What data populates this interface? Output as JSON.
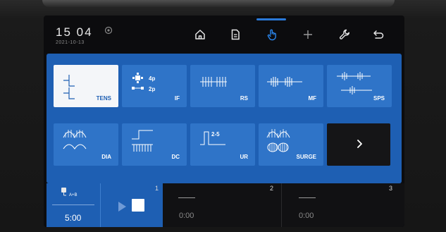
{
  "header": {
    "time": "15 04",
    "date": "2021-10-13"
  },
  "nav": [
    {
      "name": "home-icon",
      "selected": false
    },
    {
      "name": "document-icon",
      "selected": false
    },
    {
      "name": "hand-touch-icon",
      "selected": true
    },
    {
      "name": "plus-icon",
      "selected": false
    },
    {
      "name": "wrench-icon",
      "selected": false
    },
    {
      "name": "back-icon",
      "selected": false
    }
  ],
  "modes": [
    {
      "label": "TENS",
      "active": true
    },
    {
      "label": "IF",
      "sub_top": "4p",
      "sub_bottom": "2p"
    },
    {
      "label": "RS"
    },
    {
      "label": "MF"
    },
    {
      "label": "SPS"
    },
    {
      "label": "DIA"
    },
    {
      "label": "DC"
    },
    {
      "label": "UR",
      "sub_top": "2-5"
    },
    {
      "label": "SURGE"
    }
  ],
  "next_button": {
    "icon": "chevron-right-icon"
  },
  "channels": [
    {
      "number": "1",
      "electrode": "A+B",
      "time": "5:00",
      "status": "active"
    },
    {
      "number": "2",
      "time": "0:00",
      "status": "idle"
    },
    {
      "number": "3",
      "time": "0:00",
      "status": "idle"
    }
  ],
  "colors": {
    "panel": "#1e5fb3",
    "tile": "#2f74c8",
    "active_tile": "#f4f6f9",
    "accent": "#2a79d8",
    "screen_bg": "#0c0c0e"
  }
}
